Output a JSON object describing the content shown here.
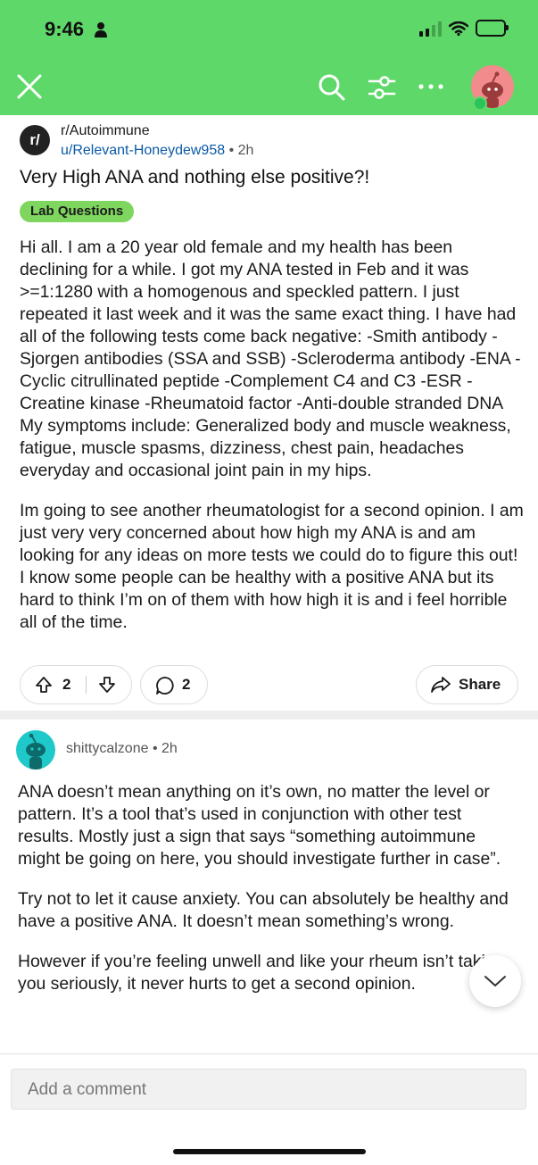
{
  "status": {
    "time": "9:46"
  },
  "post": {
    "subreddit": "r/Autoimmune",
    "sub_icon_text": "r/",
    "author": "u/Relevant-Honeydew958",
    "separator": "•",
    "age": "2h",
    "title": "Very High ANA and nothing else positive?!",
    "flair": "Lab Questions",
    "body": [
      "Hi all. I am a 20 year old female and my health has been declining for a while. I got my ANA tested in Feb and it was >=1:1280 with a homogenous and speckled pattern. I just repeated it last week and it was the same exact thing. I have had all of the following tests come back negative: -Smith antibody -Sjorgen antibodies (SSA and SSB) -Scleroderma antibody -ENA -Cyclic citrullinated peptide -Complement C4 and C3 -ESR -Creatine kinase -Rheumatoid factor -Anti-double stranded DNA My symptoms include: Generalized body and muscle weakness, fatigue, muscle spasms, dizziness, chest pain, headaches everyday and occasional joint pain in my hips.",
      "Im going to see another rheumatologist for a second opinion. I am just very very concerned about how high my ANA is and am looking for any ideas on more tests we could do to figure this out! I know some people can be healthy with a positive ANA but its hard to think I’m on of them with how high it is and i feel horrible all of the time."
    ],
    "votes": "2",
    "comments": "2",
    "share_label": "Share"
  },
  "comment": {
    "user": "shittycalzone",
    "separator": "•",
    "age": "2h",
    "body": [
      "ANA doesn’t mean anything on it’s own, no matter the level or pattern. It’s a tool that’s used in conjunction with other test results. Mostly just a sign that says “something autoimmune might be going on here, you should investigate further in case”.",
      "Try not to let it cause anxiety. You can absolutely be healthy and have a positive ANA. It doesn’t mean something’s wrong.",
      "However if you’re feeling unwell and like your rheum isn’t taking you seriously, it never hurts to get a second opinion."
    ]
  },
  "composer": {
    "placeholder": "Add a comment"
  },
  "colors": {
    "header_bg": "#5fd86a",
    "flair_bg": "#7fd65f",
    "author_link": "#0b5aa7"
  },
  "icons": [
    "close-icon",
    "search-icon",
    "filter-icon",
    "more-icon",
    "upvote-icon",
    "downvote-icon",
    "comment-icon",
    "share-icon",
    "chevron-down-icon"
  ]
}
